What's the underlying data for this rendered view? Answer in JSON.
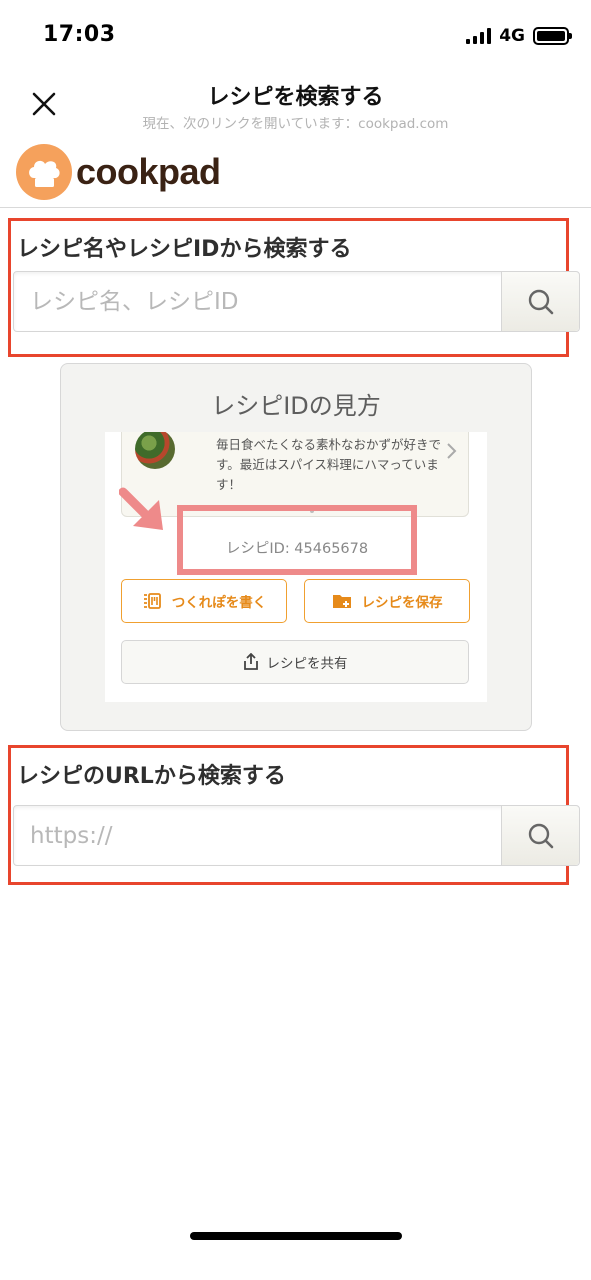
{
  "status_bar": {
    "time": "17:03",
    "network": "4G"
  },
  "header": {
    "title": "レシピを検索する",
    "subtitle": "現在、次のリンクを開いています：cookpad.com"
  },
  "brand": {
    "logo_text": "cookpad",
    "color": "#f5a15c"
  },
  "search_by_name": {
    "heading": "レシピ名やレシピIDから検索する",
    "placeholder": "レシピ名、レシピID"
  },
  "guide": {
    "title": "レシピIDの見方",
    "profile_text": "毎日食べたくなる素朴なおかずが好きです。最近はスパイス料理にハマっています！",
    "recipe_id_label": "レシピID: 45465678",
    "actions": [
      {
        "label": "つくれぽを書く",
        "icon": "tsukurepo-icon"
      },
      {
        "label": "レシピを保存",
        "icon": "folder-add-icon"
      }
    ],
    "share_label": "レシピを共有"
  },
  "search_by_url": {
    "heading": "レシピのURLから検索する",
    "placeholder": "https://"
  },
  "colors": {
    "highlight_red": "#e8452d",
    "accent_orange": "#f0a030",
    "marker_pink": "#ee8a8a"
  }
}
